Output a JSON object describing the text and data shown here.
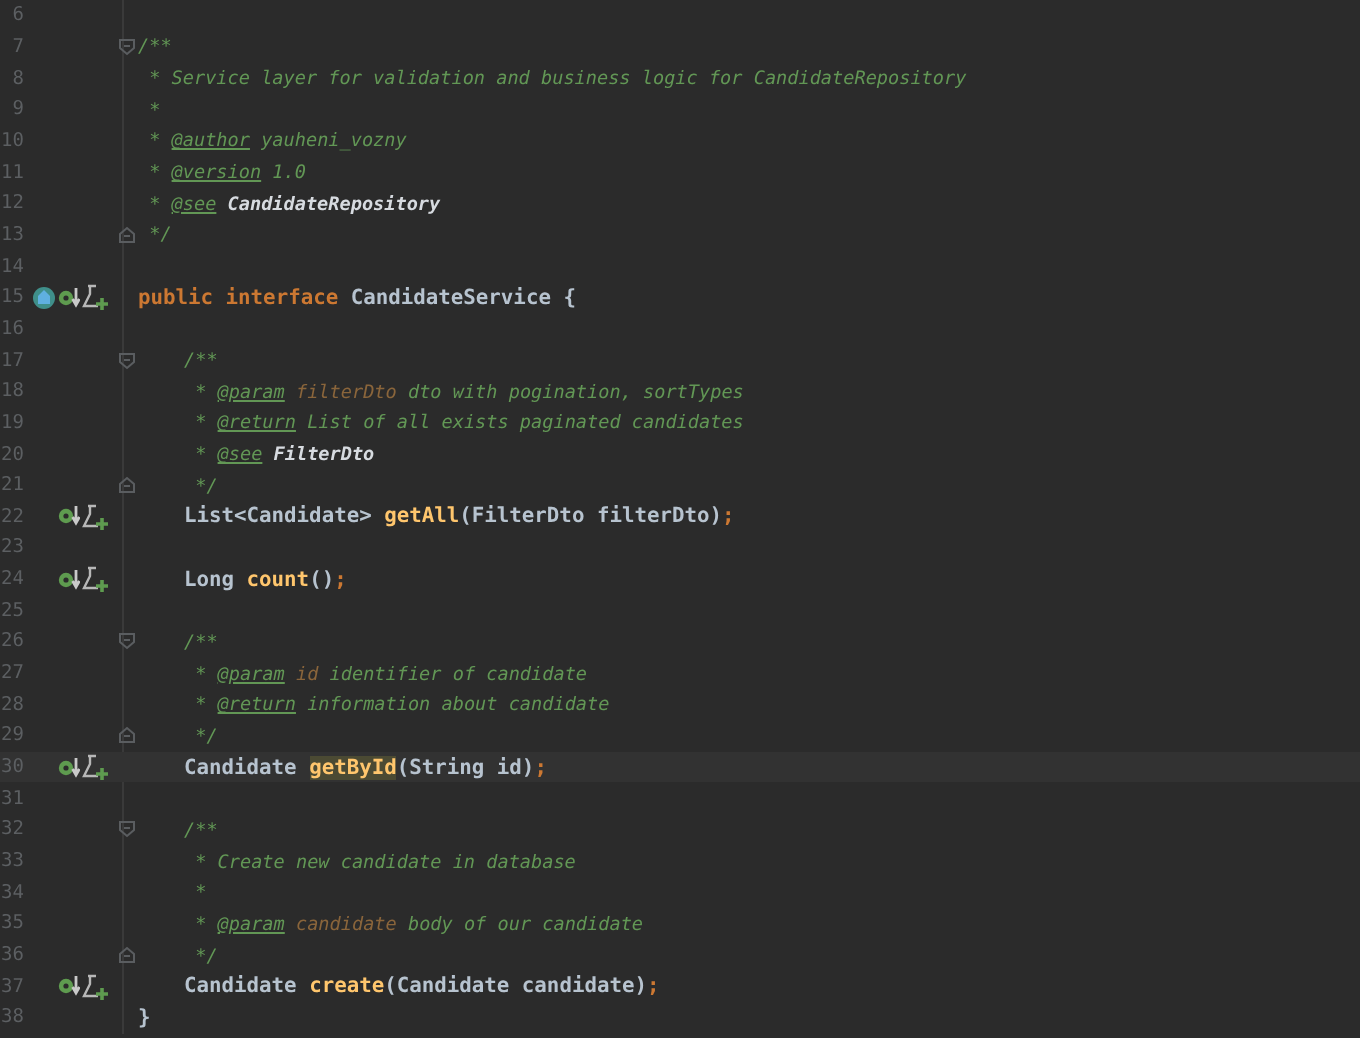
{
  "editor": {
    "lines": [
      {
        "number": "6"
      },
      {
        "number": "7",
        "fold_start": true,
        "tokens": [
          {
            "kind": "comment",
            "text": "/**"
          }
        ]
      },
      {
        "number": "8",
        "tokens": [
          {
            "kind": "comment",
            "text": " * Service layer for validation and business logic for CandidateRepository"
          }
        ]
      },
      {
        "number": "9",
        "tokens": [
          {
            "kind": "comment",
            "text": " *"
          }
        ]
      },
      {
        "number": "10",
        "tokens": [
          {
            "kind": "comment",
            "text": " * "
          },
          {
            "kind": "tag",
            "text": "@author"
          },
          {
            "kind": "comment",
            "text": " yauheni_vozny"
          }
        ]
      },
      {
        "number": "11",
        "tokens": [
          {
            "kind": "comment",
            "text": " * "
          },
          {
            "kind": "tag",
            "text": "@version"
          },
          {
            "kind": "comment",
            "text": " 1.0"
          }
        ]
      },
      {
        "number": "12",
        "tokens": [
          {
            "kind": "comment",
            "text": " * "
          },
          {
            "kind": "tag",
            "text": "@see"
          },
          {
            "kind": "ref",
            "text": " CandidateRepository"
          }
        ]
      },
      {
        "number": "13",
        "fold_end": true,
        "tokens": [
          {
            "kind": "comment",
            "text": " */"
          }
        ]
      },
      {
        "number": "14"
      },
      {
        "number": "15",
        "kind": "interface",
        "tokens": [
          {
            "kind": "keyword",
            "text": "public interface "
          },
          {
            "kind": "plain",
            "text": "CandidateService {"
          }
        ]
      },
      {
        "number": "16"
      },
      {
        "number": "17",
        "fold_start": true,
        "indent": true,
        "tokens": [
          {
            "kind": "comment",
            "text": "/**"
          }
        ]
      },
      {
        "number": "18",
        "indent": true,
        "tokens": [
          {
            "kind": "comment",
            "text": " * "
          },
          {
            "kind": "tag",
            "text": "@param"
          },
          {
            "kind": "param",
            "text": " filterDto"
          },
          {
            "kind": "comment",
            "text": " dto with pogination, sortTypes"
          }
        ]
      },
      {
        "number": "19",
        "indent": true,
        "tokens": [
          {
            "kind": "comment",
            "text": " * "
          },
          {
            "kind": "tag",
            "text": "@return"
          },
          {
            "kind": "comment",
            "text": " List of all exists paginated candidates"
          }
        ]
      },
      {
        "number": "20",
        "indent": true,
        "tokens": [
          {
            "kind": "comment",
            "text": " * "
          },
          {
            "kind": "tag",
            "text": "@see"
          },
          {
            "kind": "ref",
            "text": " FilterDto"
          }
        ]
      },
      {
        "number": "21",
        "fold_end": true,
        "indent": true,
        "tokens": [
          {
            "kind": "comment",
            "text": " */"
          }
        ]
      },
      {
        "number": "22",
        "kind": "method",
        "indent": true,
        "tokens": [
          {
            "kind": "plain",
            "text": "List<Candidate> "
          },
          {
            "kind": "method",
            "text": "getAll"
          },
          {
            "kind": "plain",
            "text": "(FilterDto filterDto)"
          },
          {
            "kind": "punct",
            "text": ";"
          }
        ]
      },
      {
        "number": "23"
      },
      {
        "number": "24",
        "kind": "method",
        "indent": true,
        "tokens": [
          {
            "kind": "plain",
            "text": "Long "
          },
          {
            "kind": "method",
            "text": "count"
          },
          {
            "kind": "plain",
            "text": "()"
          },
          {
            "kind": "punct",
            "text": ";"
          }
        ]
      },
      {
        "number": "25"
      },
      {
        "number": "26",
        "fold_start": true,
        "indent": true,
        "tokens": [
          {
            "kind": "comment",
            "text": "/**"
          }
        ]
      },
      {
        "number": "27",
        "indent": true,
        "tokens": [
          {
            "kind": "comment",
            "text": " * "
          },
          {
            "kind": "tag",
            "text": "@param"
          },
          {
            "kind": "param",
            "text": " id"
          },
          {
            "kind": "comment",
            "text": " identifier of candidate"
          }
        ]
      },
      {
        "number": "28",
        "indent": true,
        "tokens": [
          {
            "kind": "comment",
            "text": " * "
          },
          {
            "kind": "tag",
            "text": "@return"
          },
          {
            "kind": "comment",
            "text": " information about candidate"
          }
        ]
      },
      {
        "number": "29",
        "fold_end": true,
        "indent": true,
        "tokens": [
          {
            "kind": "comment",
            "text": " */"
          }
        ]
      },
      {
        "number": "30",
        "kind": "method",
        "indent": true,
        "current": true,
        "tokens": [
          {
            "kind": "plain",
            "text": "Candidate "
          },
          {
            "kind": "method-hl",
            "text": "getById"
          },
          {
            "kind": "plain",
            "text": "(String id)"
          },
          {
            "kind": "punct",
            "text": ";"
          }
        ]
      },
      {
        "number": "31"
      },
      {
        "number": "32",
        "fold_start": true,
        "indent": true,
        "tokens": [
          {
            "kind": "comment",
            "text": "/**"
          }
        ]
      },
      {
        "number": "33",
        "indent": true,
        "tokens": [
          {
            "kind": "comment",
            "text": " * Create new candidate in database"
          }
        ]
      },
      {
        "number": "34",
        "indent": true,
        "tokens": [
          {
            "kind": "comment",
            "text": " *"
          }
        ]
      },
      {
        "number": "35",
        "indent": true,
        "tokens": [
          {
            "kind": "comment",
            "text": " * "
          },
          {
            "kind": "tag",
            "text": "@param"
          },
          {
            "kind": "param",
            "text": " candidate"
          },
          {
            "kind": "comment",
            "text": " body of our candidate"
          }
        ]
      },
      {
        "number": "36",
        "fold_end": true,
        "indent": true,
        "tokens": [
          {
            "kind": "comment",
            "text": " */"
          }
        ]
      },
      {
        "number": "37",
        "kind": "method",
        "indent": true,
        "tokens": [
          {
            "kind": "plain",
            "text": "Candidate "
          },
          {
            "kind": "method",
            "text": "create"
          },
          {
            "kind": "plain",
            "text": "(Candidate candidate)"
          },
          {
            "kind": "punct",
            "text": ";"
          }
        ]
      },
      {
        "number": "38",
        "tokens": [
          {
            "kind": "plain",
            "text": "}"
          }
        ]
      }
    ]
  }
}
